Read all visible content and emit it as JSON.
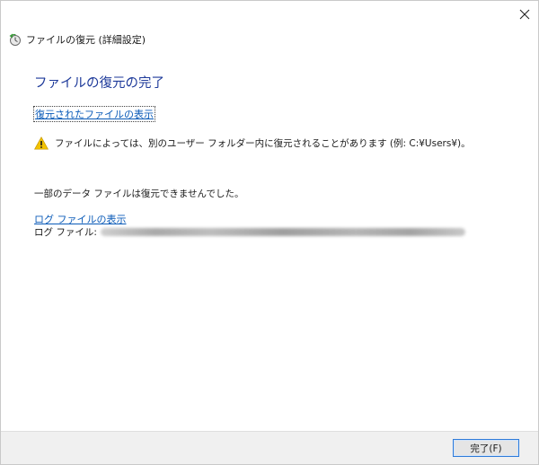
{
  "window": {
    "title": "ファイルの復元 (詳細設定)"
  },
  "main": {
    "heading": "ファイルの復元の完了",
    "show_restored_link": "復元されたファイルの表示",
    "warning_message": "ファイルによっては、別のユーザー フォルダー内に復元されることがあります (例: C:¥Users¥)。",
    "partial_failure_message": "一部のデータ ファイルは復元できませんでした。",
    "view_log_link": "ログ ファイルの表示",
    "log_file_label": "ログ ファイル:"
  },
  "footer": {
    "finish_button": "完了(F)"
  },
  "colors": {
    "heading": "#1e3a9a",
    "link": "#0b5bb8",
    "warning": "#f2c200",
    "footer_bg": "#f0f0f0",
    "button_border": "#2f7bd8"
  },
  "icons": {
    "app": "restore-files-icon",
    "warning": "warning-icon",
    "close": "close-icon"
  }
}
